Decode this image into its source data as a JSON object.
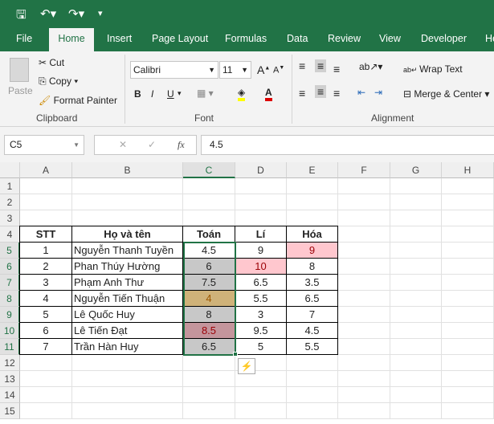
{
  "quick_access": {
    "save": "save-icon",
    "undo": "undo-icon",
    "redo": "redo-icon",
    "customize": "▾"
  },
  "tabs": [
    "File",
    "Home",
    "Insert",
    "Page Layout",
    "Formulas",
    "Data",
    "Review",
    "View",
    "Developer",
    "He"
  ],
  "ribbon": {
    "clipboard": {
      "paste": "Paste",
      "cut": "Cut",
      "copy": "Copy",
      "format_painter": "Format Painter",
      "group": "Clipboard"
    },
    "font": {
      "name": "Calibri",
      "size": "11",
      "bold": "B",
      "italic": "I",
      "underline": "U",
      "group": "Font"
    },
    "alignment": {
      "wrap_text": "Wrap Text",
      "merge_center": "Merge & Center",
      "group": "Alignment"
    }
  },
  "formula_bar": {
    "name_box": "C5",
    "fx": "fx",
    "value": "4.5"
  },
  "columns": [
    "A",
    "B",
    "C",
    "D",
    "E",
    "F",
    "G",
    "H"
  ],
  "rows": [
    "1",
    "2",
    "3",
    "4",
    "5",
    "6",
    "7",
    "8",
    "9",
    "10",
    "11",
    "12",
    "13",
    "14",
    "15"
  ],
  "table": {
    "headers": [
      "STT",
      "Họ và tên",
      "Toán",
      "Lí",
      "Hóa"
    ],
    "data": [
      [
        "1",
        "Nguyễn Thanh Tuyền",
        "4.5",
        "9",
        "9"
      ],
      [
        "2",
        "Phan Thúy Hường",
        "6",
        "10",
        "8"
      ],
      [
        "3",
        "Phạm Anh Thư",
        "7.5",
        "6.5",
        "3.5"
      ],
      [
        "4",
        "Nguyễn Tiến Thuận",
        "4",
        "5.5",
        "6.5"
      ],
      [
        "5",
        "Lê Quốc Huy",
        "8",
        "3",
        "7"
      ],
      [
        "6",
        "Lê Tiến Đạt",
        "8.5",
        "9.5",
        "4.5"
      ],
      [
        "7",
        "Trần Hàn Huy",
        "6.5",
        "5",
        "5.5"
      ]
    ]
  },
  "colors": {
    "brand": "#217346",
    "pink_fill": "#ffc7ce",
    "pink_text": "#9c0006",
    "gray_fill": "#c8c8c8",
    "gold_fill": "#cfb279",
    "gold_text": "#9c5700",
    "rose_fill": "#c4959c"
  }
}
